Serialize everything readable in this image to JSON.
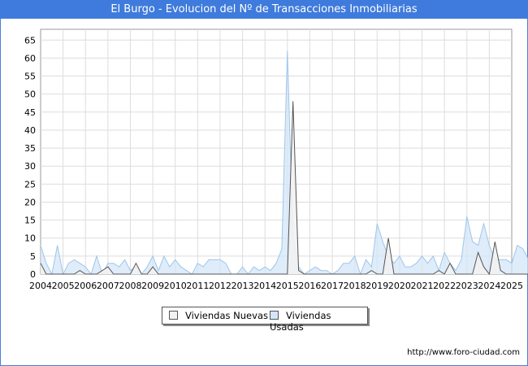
{
  "title": "El Burgo - Evolucion del Nº de Transacciones Inmobiliarias",
  "source_url": "http://www.foro-ciudad.com",
  "colors": {
    "title_bg": "#3f7bdc",
    "nuevas_fill": "#f2f2f2",
    "nuevas_line": "#555555",
    "usadas_fill": "#d4e6f8",
    "usadas_line": "#9ec6ea"
  },
  "chart_data": {
    "type": "area",
    "title": "El Burgo - Evolucion del Nº de Transacciones Inmobiliarias",
    "xlabel": "",
    "ylabel": "",
    "x_start_year": 2004,
    "points_per_year": 4,
    "x_ticks": [
      "2004",
      "2005",
      "2006",
      "2007",
      "2008",
      "2009",
      "2010",
      "2011",
      "2012",
      "2013",
      "2014",
      "2015",
      "2016",
      "2017",
      "2018",
      "2019",
      "2020",
      "2021",
      "2022",
      "2023",
      "2024",
      "2025"
    ],
    "y_ticks": [
      0,
      5,
      10,
      15,
      20,
      25,
      30,
      35,
      40,
      45,
      50,
      55,
      60,
      65
    ],
    "ylim": [
      0,
      68
    ],
    "grid": true,
    "legend_position": "bottom-center",
    "series": [
      {
        "name": "Viviendas Nuevas",
        "values": [
          3,
          0,
          0,
          0,
          0,
          0,
          0,
          1,
          0,
          0,
          0,
          1,
          2,
          0,
          0,
          0,
          0,
          3,
          0,
          0,
          2,
          0,
          0,
          0,
          0,
          0,
          0,
          0,
          0,
          0,
          0,
          0,
          0,
          0,
          0,
          0,
          0,
          0,
          0,
          0,
          0,
          0,
          0,
          0,
          0,
          48,
          1,
          0,
          0,
          0,
          0,
          0,
          0,
          0,
          0,
          0,
          0,
          0,
          0,
          1,
          0,
          0,
          10,
          0,
          0,
          0,
          0,
          0,
          0,
          0,
          0,
          1,
          0,
          3,
          0,
          0,
          0,
          0,
          6,
          2,
          0,
          9,
          1,
          0,
          0,
          0,
          0,
          0,
          0
        ]
      },
      {
        "name": "Viviendas Usadas",
        "values": [
          8,
          3,
          0,
          8,
          0,
          3,
          4,
          3,
          2,
          0,
          5,
          0,
          3,
          3,
          2,
          4,
          1,
          2,
          0,
          2,
          5,
          1,
          5,
          2,
          4,
          2,
          1,
          0,
          3,
          2,
          4,
          4,
          4,
          3,
          0,
          0,
          2,
          0,
          2,
          1,
          2,
          1,
          3,
          7,
          62,
          10,
          2,
          0,
          1,
          2,
          1,
          1,
          0,
          1,
          3,
          3,
          5,
          0,
          4,
          2,
          14,
          9,
          5,
          3,
          5,
          2,
          2,
          3,
          5,
          3,
          5,
          1,
          6,
          3,
          1,
          4,
          16,
          9,
          8,
          14,
          8,
          4,
          4,
          4,
          3,
          8,
          7,
          4
        ]
      }
    ]
  }
}
